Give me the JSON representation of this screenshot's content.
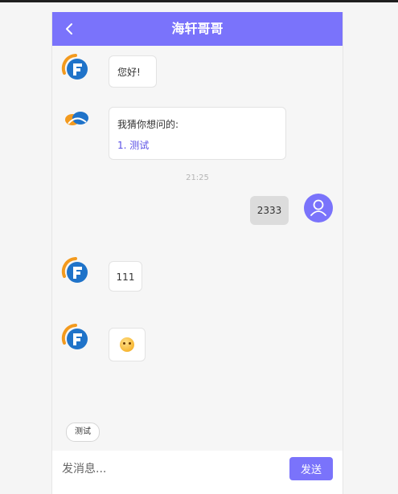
{
  "header": {
    "title": "海轩哥哥"
  },
  "messages": [
    {
      "text": "您好!"
    },
    {
      "prompt": "我猜你想问的:",
      "suggestion": "1. 测试"
    },
    {
      "time": "21:25"
    },
    {
      "text": "2333"
    },
    {
      "text": "111"
    },
    {
      "emoji": "astonished-face"
    }
  ],
  "quick_reply": {
    "label": "测试"
  },
  "composer": {
    "placeholder": "发消息...",
    "send_label": "发送"
  },
  "colors": {
    "accent": "#7a73fb",
    "logo_orange": "#f39a1e",
    "logo_blue": "#1f73c9"
  },
  "icons": {
    "back": "chevron-left-icon",
    "user": "user-icon",
    "logo": "f-logo-icon"
  }
}
